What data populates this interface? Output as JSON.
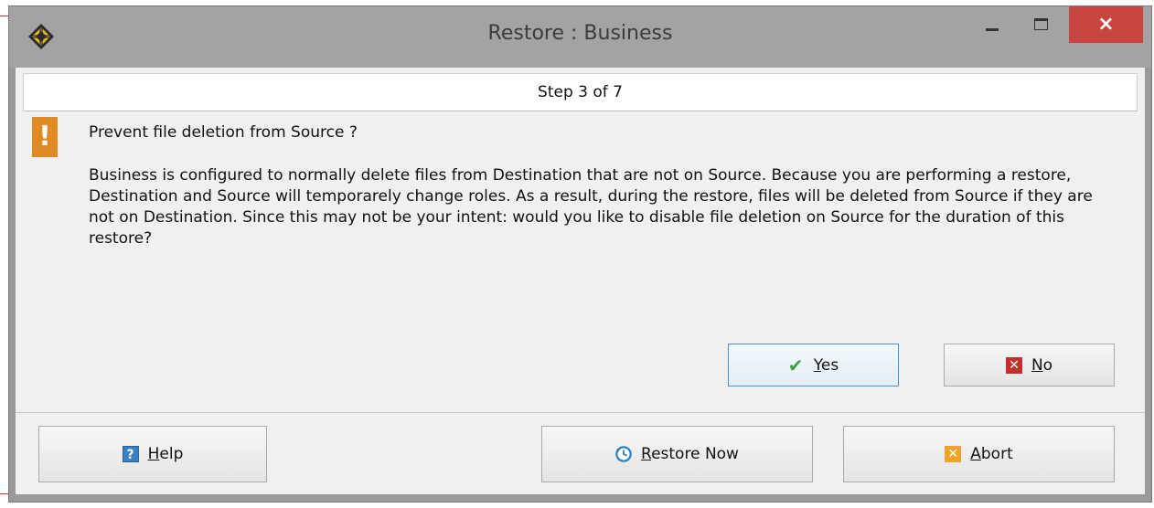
{
  "window": {
    "title": "Restore : Business",
    "close_glyph": "×"
  },
  "step": {
    "label": "Step 3 of 7"
  },
  "message": {
    "question": "Prevent file deletion from Source ?",
    "body": "Business is configured to normally delete files from Destination that are not on Source. Because you are performing a restore, Destination and Source will temporarely change roles. As a result, during the restore, files will be deleted from Source if they are not on Destination. Since this may not be your intent: would you like to disable file deletion on Source for the duration of this restore?",
    "icon": "warning-exclamation-icon",
    "icon_glyph": "!"
  },
  "answer_buttons": {
    "yes": {
      "mnemonic": "Y",
      "rest": "es",
      "icon": "checkmark-icon"
    },
    "no": {
      "mnemonic": "N",
      "rest": "o",
      "icon": "red-x-icon"
    }
  },
  "footer_buttons": {
    "help": {
      "mnemonic": "H",
      "rest": "elp",
      "icon": "help-question-icon"
    },
    "restore_now": {
      "mnemonic": "R",
      "rest": "estore Now",
      "icon": "clock-restore-icon"
    },
    "abort": {
      "mnemonic": "A",
      "rest": "bort",
      "icon": "abort-x-icon"
    }
  },
  "colors": {
    "titlebar": "#a3a3a3",
    "close_button": "#c7463f",
    "warning": "#e08a23",
    "focus_border": "#4a90c8"
  }
}
